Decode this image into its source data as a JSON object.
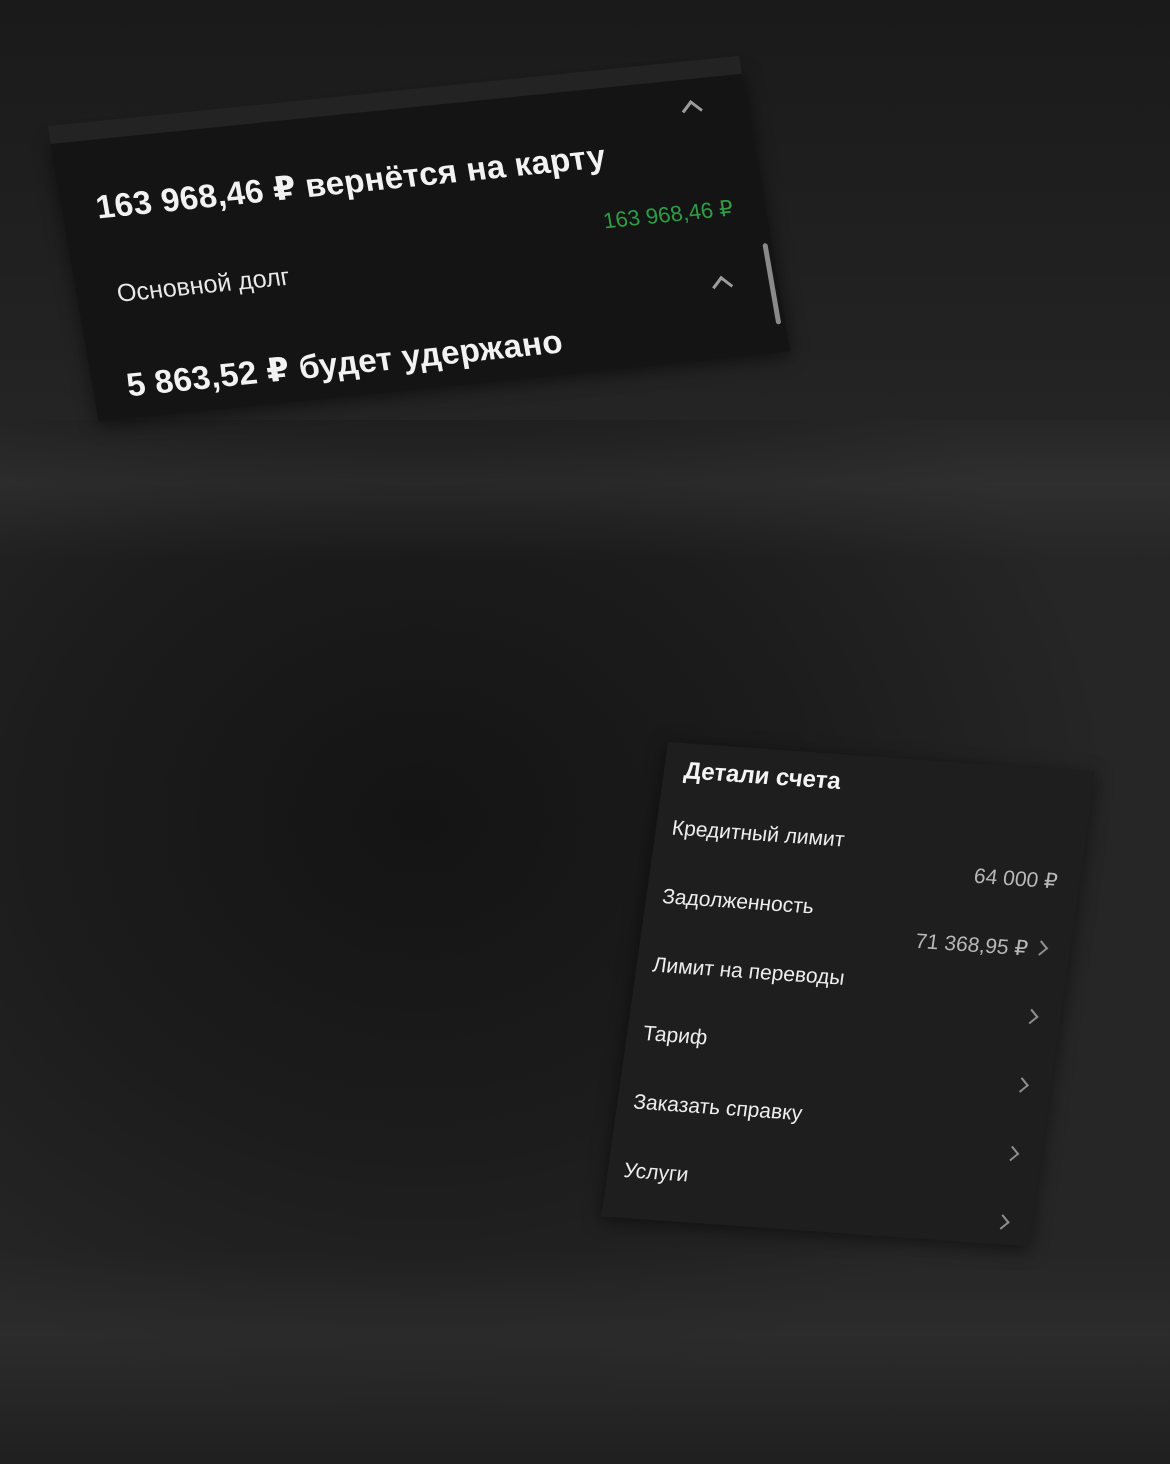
{
  "summary": {
    "refund_headline": "163 968,46 ₽ вернётся на карту",
    "principal_label": "Основной долг",
    "principal_amount": "163 968,46 ₽",
    "withheld_headline": "5 863,52 ₽ будет удержано",
    "accent_color": "#2e9d45",
    "expand_icon": "chevron-up-icon"
  },
  "details": {
    "title": "Детали счета",
    "items": [
      {
        "label": "Кредитный лимит",
        "value": "64 000 ₽",
        "has_chevron": false
      },
      {
        "label": "Задолженность",
        "value": "71 368,95 ₽",
        "has_chevron": true
      },
      {
        "label": "Лимит на переводы",
        "value": "",
        "has_chevron": true
      },
      {
        "label": "Тариф",
        "value": "",
        "has_chevron": true
      },
      {
        "label": "Заказать справку",
        "value": "",
        "has_chevron": true
      },
      {
        "label": "Услуги",
        "value": "",
        "has_chevron": true
      }
    ],
    "nav_icon": "chevron-right-icon"
  }
}
